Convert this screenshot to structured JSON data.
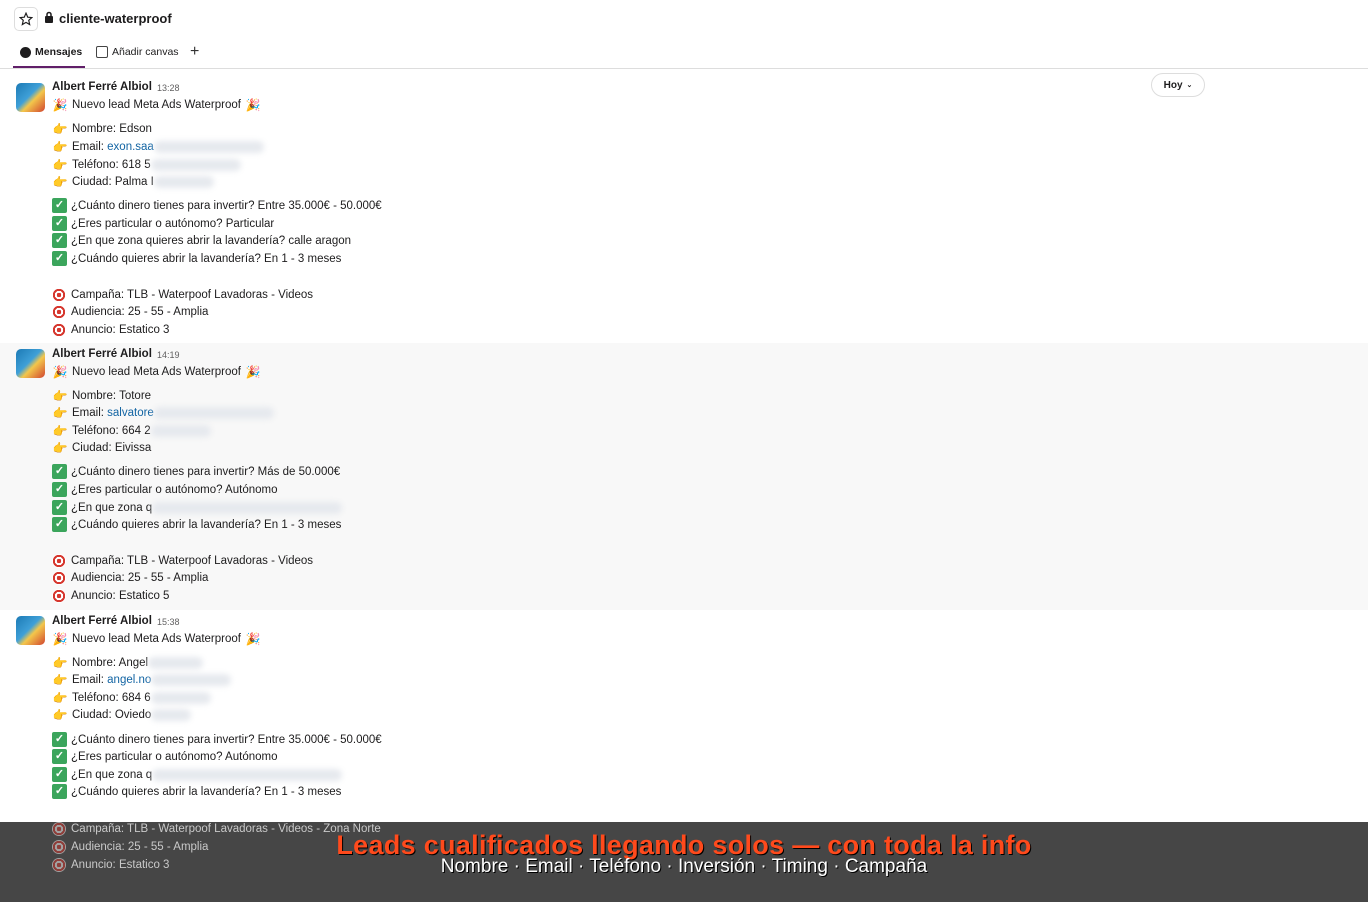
{
  "channel": {
    "name": "cliente-waterproof"
  },
  "tabs": {
    "messages": "Mensajes",
    "canvas": "Añadir canvas",
    "add": "+"
  },
  "date_pill": {
    "label": "Hoy"
  },
  "messages": [
    {
      "author": "Albert Ferré Albiol",
      "time": "13:28",
      "headline": "Nuevo lead Meta Ads Waterproof",
      "nombre": "Nombre: Edson",
      "email_prefix": "Email: ",
      "email_link": "exon.saa",
      "telefono": "Teléfono: 618 5",
      "ciudad": "Ciudad: Palma I",
      "q1": "¿Cuánto dinero tienes para invertir? Entre 35.000€ - 50.000€",
      "q2": "¿Eres particular o autónomo? Particular",
      "q3": "¿En que zona quieres abrir la lavandería? calle aragon",
      "q4": "¿Cuándo quieres abrir la lavandería? En 1 - 3 meses",
      "campana": "Campaña: TLB - Waterpoof Lavadoras - Videos",
      "audiencia": "Audiencia: 25 - 55 - Amplia",
      "anuncio": "Anuncio: Estatico 3"
    },
    {
      "author": "Albert Ferré Albiol",
      "time": "14:19",
      "headline": "Nuevo lead Meta Ads Waterproof",
      "nombre": "Nombre: Totore",
      "email_prefix": "Email: ",
      "email_link": "salvatore",
      "telefono": "Teléfono: 664 2",
      "ciudad": "Ciudad: Eivissa",
      "q1": "¿Cuánto dinero tienes para invertir? Más de 50.000€",
      "q2": "¿Eres particular o autónomo? Autónomo",
      "q3": "¿En que zona q",
      "q4": "¿Cuándo quieres abrir la lavandería? En 1 - 3 meses",
      "campana": "Campaña: TLB - Waterpoof Lavadoras - Videos",
      "audiencia": "Audiencia: 25 - 55 - Amplia",
      "anuncio": "Anuncio: Estatico 5"
    },
    {
      "author": "Albert Ferré Albiol",
      "time": "15:38",
      "headline": "Nuevo lead Meta Ads Waterproof",
      "nombre": "Nombre: Angel",
      "email_prefix": "Email: ",
      "email_link": "angel.no",
      "telefono": "Teléfono: 684 6",
      "ciudad": "Ciudad: Oviedo",
      "q1": "¿Cuánto dinero tienes para invertir? Entre 35.000€ - 50.000€",
      "q2": "¿Eres particular o autónomo? Autónomo",
      "q3": "¿En que zona q",
      "q4": "¿Cuándo quieres abrir la lavandería? En 1 - 3 meses",
      "campana": "Campaña: TLB - Waterpoof Lavadoras - Videos - Zona Norte",
      "audiencia": "Audiencia: 25 - 55 - Amplia",
      "anuncio": "Anuncio: Estatico 3"
    }
  ],
  "banner": {
    "title": "Leads cualificados llegando solos — con toda la info",
    "subtitle": "Nombre · Email · Teléfono · Inversión · Timing · Campaña"
  },
  "colors": {
    "accent": "#611f69",
    "link": "#1264a3",
    "banner_title": "#ff4a1c"
  },
  "icons": {
    "star": "star-icon",
    "lock": "lock-icon",
    "party": "party-popper-icon",
    "point": "pointing-hand-icon",
    "check": "check-mark-icon",
    "target": "direct-hit-icon"
  }
}
